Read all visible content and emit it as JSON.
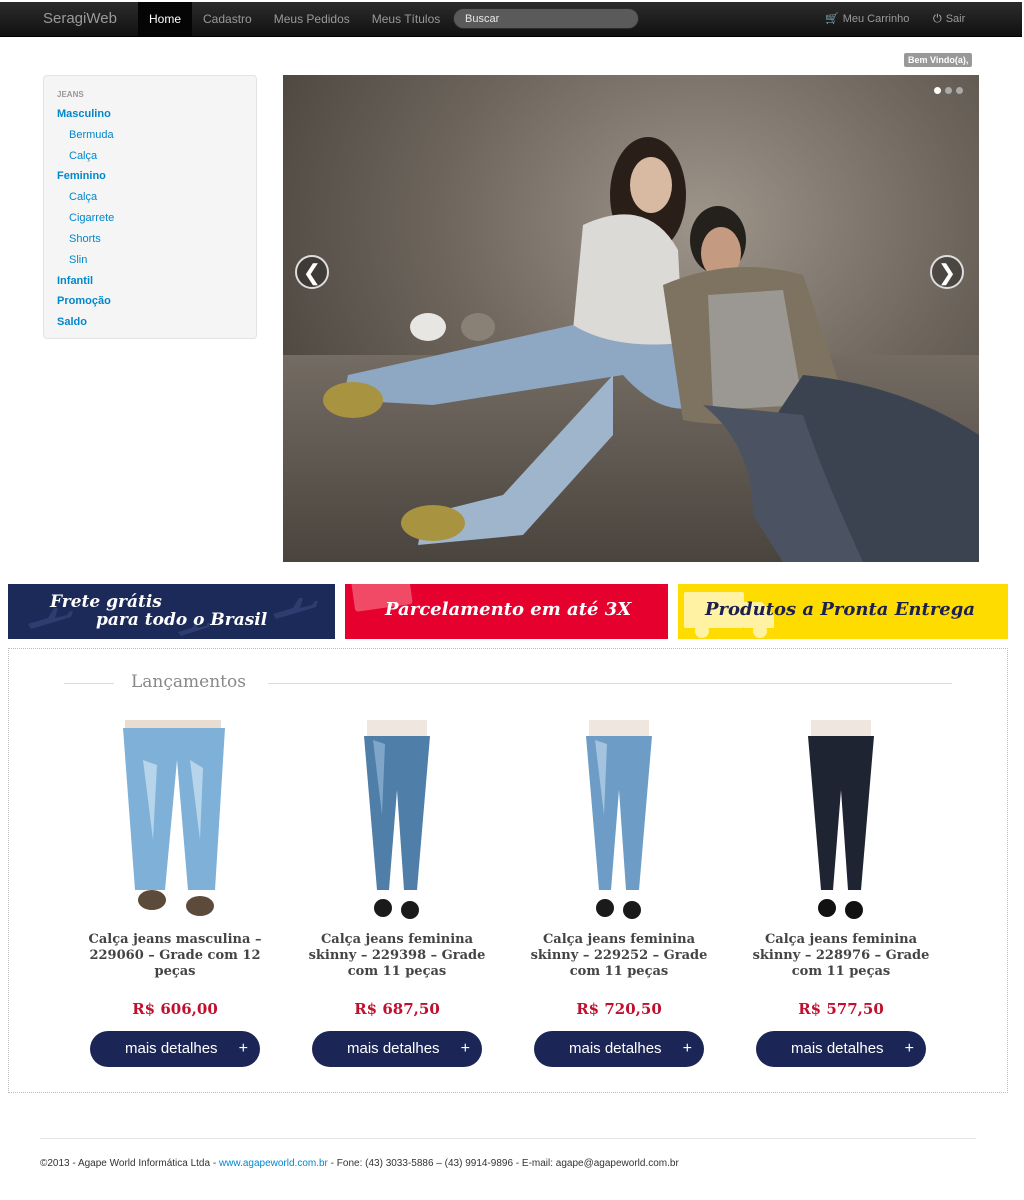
{
  "navbar": {
    "brand": "SeragiWeb",
    "items": [
      "Home",
      "Cadastro",
      "Meus Pedidos",
      "Meus Títulos"
    ],
    "active": "Home",
    "search_placeholder": "Buscar",
    "cart_label": "Meu Carrinho",
    "exit_label": "Sair"
  },
  "welcome": "Bem Vindo(a),",
  "sidebar": {
    "header": "JEANS",
    "items": [
      "Masculino",
      "Bermuda",
      "Calça",
      "Feminino",
      "Calça",
      "Cigarrete",
      "Shorts",
      "Slin",
      "Infantil",
      "Promoção",
      "Saldo"
    ]
  },
  "carousel": {
    "prev": "❮",
    "next": "❯",
    "slides": 3,
    "active_slide": 1
  },
  "banners": {
    "frete_line1": "Frete grátis",
    "frete_line2": "para todo o Brasil",
    "parcelamento": "Parcelamento em até 3X",
    "pronta_entrega": "Produtos a Pronta Entrega"
  },
  "section_title": "Lançamentos",
  "products": [
    {
      "name": "Calça jeans masculina – 229060 – Grade com 12 peças",
      "price": "R$ 606,00",
      "button": "mais detalhes"
    },
    {
      "name": "Calça jeans feminina skinny – 229398 – Grade com 11 peças",
      "price": "R$ 687,50",
      "button": "mais detalhes"
    },
    {
      "name": "Calça jeans feminina skinny – 229252 – Grade com 11 peças",
      "price": "R$ 720,50",
      "button": "mais detalhes"
    },
    {
      "name": "Calça jeans feminina skinny – 228976 – Grade com 11 peças",
      "price": "R$ 577,50",
      "button": "mais detalhes"
    }
  ],
  "footer": {
    "prefix": "©2013 - Agape World Informática Ltda - ",
    "link": "www.agapeworld.com.br",
    "suffix": " - Fone: (43) 3033-5886 – (43) 9914-9896 - E-mail: agape@agapeworld.com.br"
  },
  "colors": {
    "banner_blue": "#1c2a5a",
    "banner_red": "#e6002d",
    "banner_yellow": "#ffdc00",
    "price": "#c0102e",
    "button": "#1c2656"
  }
}
